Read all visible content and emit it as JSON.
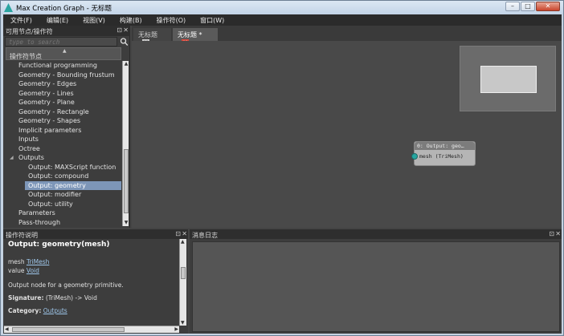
{
  "window": {
    "title": "Max Creation Graph - 无标题",
    "buttons": {
      "minimize": "–",
      "maximize": "□",
      "close": "✕"
    }
  },
  "menu": [
    {
      "label": "文件(F)"
    },
    {
      "label": "编辑(E)"
    },
    {
      "label": "视图(V)"
    },
    {
      "label": "构建(B)"
    },
    {
      "label": "操作符(O)"
    },
    {
      "label": "窗口(W)"
    }
  ],
  "operators_panel": {
    "title": "可用节点/操作符",
    "search_placeholder": "type to search",
    "tree_header": "操作符节点",
    "items": [
      {
        "label": "Functional programming",
        "level": 1
      },
      {
        "label": "Geometry - Bounding frustum",
        "level": 1
      },
      {
        "label": "Geometry - Edges",
        "level": 1
      },
      {
        "label": "Geometry - Lines",
        "level": 1
      },
      {
        "label": "Geometry - Plane",
        "level": 1
      },
      {
        "label": "Geometry - Rectangle",
        "level": 1
      },
      {
        "label": "Geometry - Shapes",
        "level": 1
      },
      {
        "label": "Implicit parameters",
        "level": 1
      },
      {
        "label": "Inputs",
        "level": 1
      },
      {
        "label": "Octree",
        "level": 1
      },
      {
        "label": "Outputs",
        "level": 1,
        "expanded": true
      },
      {
        "label": "Output: MAXScript function",
        "level": 2
      },
      {
        "label": "Output: compound",
        "level": 2
      },
      {
        "label": "Output: geometry",
        "level": 2,
        "selected": true
      },
      {
        "label": "Output: modifier",
        "level": 2
      },
      {
        "label": "Output: utility",
        "level": 2
      },
      {
        "label": "Parameters",
        "level": 1
      },
      {
        "label": "Pass-through",
        "level": 1
      }
    ]
  },
  "tabs": [
    {
      "label": "无标题",
      "close": "✕"
    },
    {
      "label": "无标题 *",
      "close": "✕",
      "active": true
    }
  ],
  "graph": {
    "node": {
      "title": "0: Output: geo…",
      "port": "mesh (TriMesh)"
    }
  },
  "description_panel": {
    "title": "操作符说明",
    "op_title": "Output: geometry(mesh)",
    "param1_name": "mesh",
    "param1_type": "TriMesh",
    "param2_name": "value",
    "param2_type": "Void",
    "text": "Output node for a geometry primitive.",
    "signature_label": "Signature:",
    "signature_value": "(TriMesh) -> Void",
    "category_label": "Category:",
    "category_value": "Outputs"
  },
  "log_panel": {
    "title": "消息日志"
  }
}
